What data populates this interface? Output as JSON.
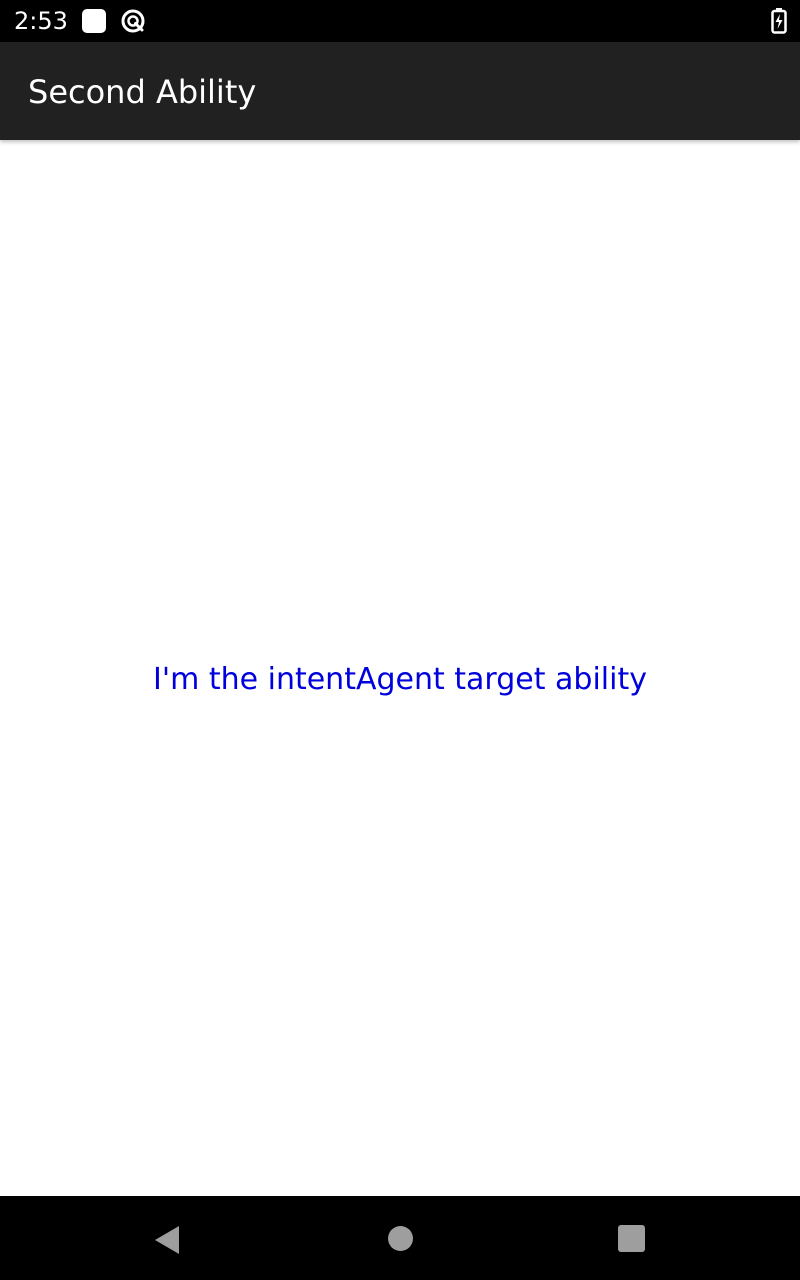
{
  "status_bar": {
    "time": "2:53",
    "icons": [
      "notification-square-icon",
      "sync-circle-icon",
      "battery-charging-icon"
    ]
  },
  "app_bar": {
    "title": "Second Ability"
  },
  "content": {
    "message": "I'm the intentAgent target ability"
  },
  "nav_bar": {
    "icons": [
      "back-icon",
      "home-icon",
      "recents-icon"
    ]
  },
  "colors": {
    "status_bar_bg": "#000000",
    "app_bar_bg": "#212121",
    "title_text": "#ffffff",
    "message_text": "#0000dd",
    "nav_icon": "#9e9e9e",
    "content_bg": "#ffffff"
  }
}
